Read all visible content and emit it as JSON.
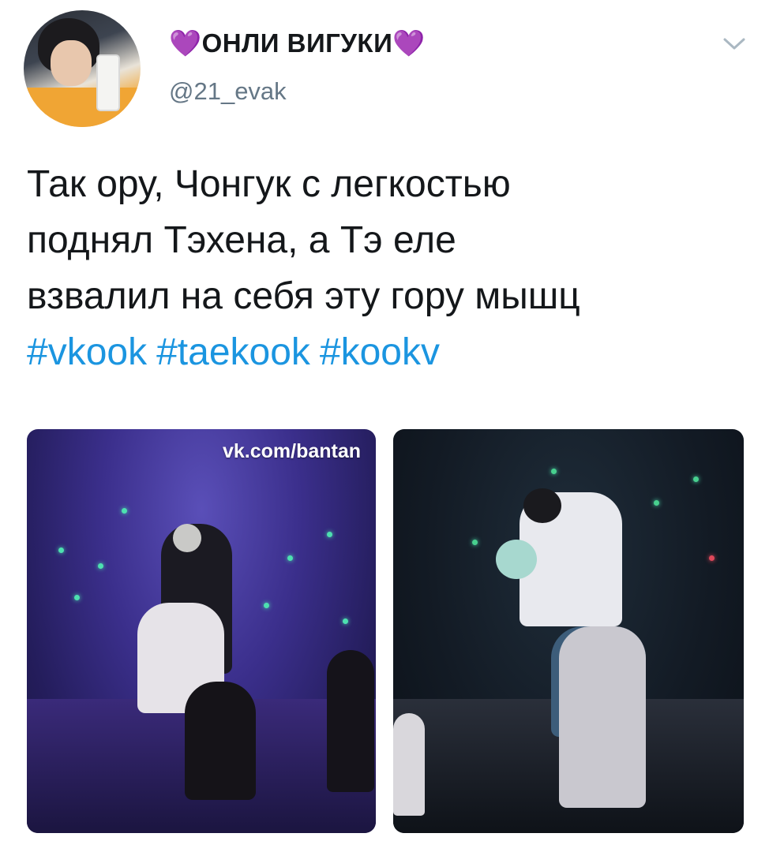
{
  "author": {
    "display_name_prefix": "💜",
    "display_name": "ОНЛИ ВИГУКИ",
    "display_name_suffix": "💜",
    "handle": "@21_evak",
    "heart_color": "#a34ce0"
  },
  "tweet": {
    "text_lines": [
      "Так ору, Чонгук с легкостью",
      "поднял Тэхена, а Тэ еле",
      "взвалил на себя эту гору мышц"
    ],
    "hashtags": [
      "#vkook",
      "#taekook",
      "#kookv"
    ],
    "hashtag_color": "#1b95e0"
  },
  "media": {
    "watermark": "vk.com/bantan"
  },
  "icons": {
    "menu": "chevron-down-icon",
    "avatar": "profile-avatar"
  }
}
